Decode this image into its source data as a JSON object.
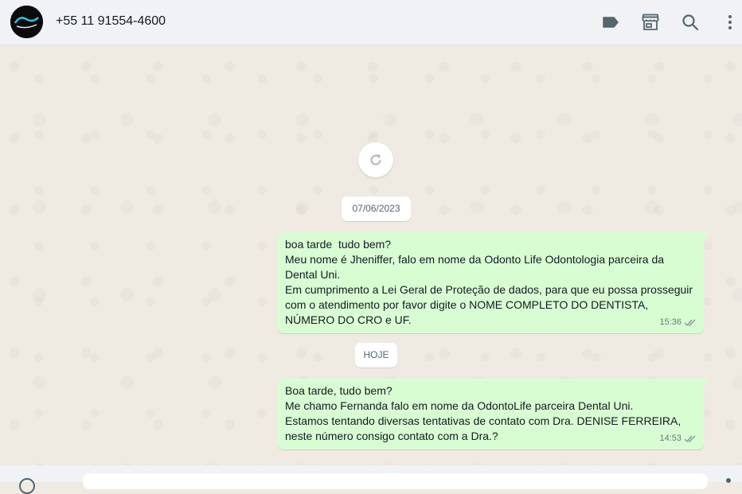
{
  "header": {
    "contact_name": "+55 11 91554-4600",
    "icons": [
      "label-icon",
      "store-icon",
      "search-icon",
      "menu-dots-icon"
    ]
  },
  "chat": {
    "refresh_icon": "refresh-icon",
    "dates": {
      "first": "07/06/2023",
      "second": "HOJE"
    },
    "messages": [
      {
        "lines": [
          "boa tarde  tudo bem?",
          "Meu nome é Jheniffer, falo em nome da Odonto Life Odontologia parceira da Dental Uni.",
          "Em cumprimento a Lei Geral de Proteção de dados, para que eu possa prosseguir com o atendimento por favor digite o NOME COMPLETO DO DENTISTA, NÚMERO DO CRO e UF."
        ],
        "time": "15:36",
        "status_icon": "double-check-icon"
      },
      {
        "lines": [
          "Boa tarde, tudo bem?",
          "Me chamo Fernanda falo em nome da OdontoLife parceira Dental Uni.",
          "Estamos tentando diversas tentativas de contato com Dra. DENISE FERREIRA, neste número consigo contato com a Dra.?"
        ],
        "time": "14:53",
        "status_icon": "double-check-icon"
      }
    ]
  },
  "colors": {
    "header_bg": "#f0f2f5",
    "chat_bg": "#efeae2",
    "outgoing_bubble": "#d9fdd3",
    "icon": "#54656f",
    "meta_text": "#667781"
  }
}
